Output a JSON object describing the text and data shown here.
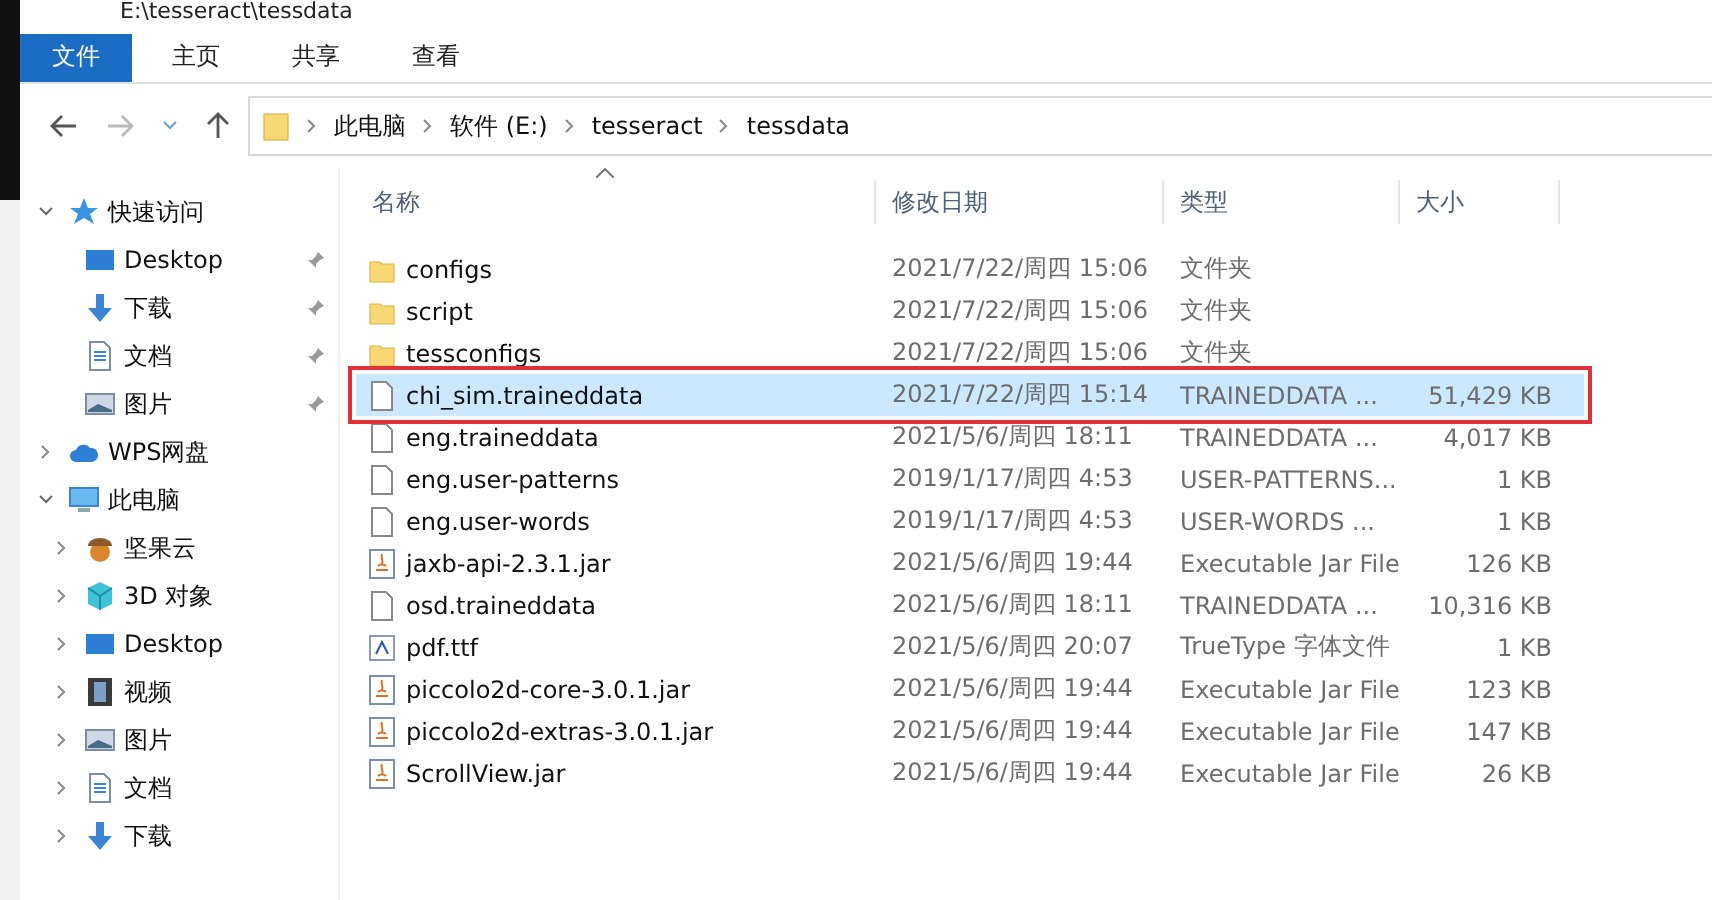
{
  "window": {
    "title": "E:\\tesseract\\tessdata"
  },
  "ribbon_tabs": [
    {
      "label": "文件",
      "selected": true
    },
    {
      "label": "主页",
      "selected": false
    },
    {
      "label": "共享",
      "selected": false
    },
    {
      "label": "查看",
      "selected": false
    }
  ],
  "breadcrumb": [
    "此电脑",
    "软件 (E:)",
    "tesseract",
    "tessdata"
  ],
  "sidebar": {
    "items": [
      {
        "label": "快速访问",
        "kind": "star",
        "expanded": true,
        "children": [
          {
            "label": "Desktop",
            "kind": "desktop",
            "pinned": true
          },
          {
            "label": "下载",
            "kind": "download",
            "pinned": true
          },
          {
            "label": "文档",
            "kind": "document",
            "pinned": true
          },
          {
            "label": "图片",
            "kind": "picture",
            "pinned": true
          }
        ]
      },
      {
        "label": "WPS网盘",
        "kind": "cloud",
        "expanded": false
      },
      {
        "label": "此电脑",
        "kind": "computer",
        "expanded": true,
        "children": [
          {
            "label": "坚果云",
            "kind": "nut",
            "expanded": false
          },
          {
            "label": "3D 对象",
            "kind": "cube",
            "expanded": false
          },
          {
            "label": "Desktop",
            "kind": "desktop",
            "expanded": false
          },
          {
            "label": "视频",
            "kind": "video",
            "expanded": false
          },
          {
            "label": "图片",
            "kind": "picture",
            "expanded": false
          },
          {
            "label": "文档",
            "kind": "document",
            "expanded": false
          },
          {
            "label": "下载",
            "kind": "download",
            "expanded": false
          }
        ]
      }
    ]
  },
  "table": {
    "columns": [
      "名称",
      "修改日期",
      "类型",
      "大小"
    ],
    "rows": [
      {
        "kind": "folder",
        "name": "configs",
        "date": "2021/7/22/周四 15:06",
        "type": "文件夹",
        "size": "",
        "selected": false,
        "outlined": false
      },
      {
        "kind": "folder",
        "name": "script",
        "date": "2021/7/22/周四 15:06",
        "type": "文件夹",
        "size": "",
        "selected": false,
        "outlined": false
      },
      {
        "kind": "folder",
        "name": "tessconfigs",
        "date": "2021/7/22/周四 15:06",
        "type": "文件夹",
        "size": "",
        "selected": false,
        "outlined": false
      },
      {
        "kind": "file",
        "name": "chi_sim.traineddata",
        "date": "2021/7/22/周四 15:14",
        "type": "TRAINEDDATA ...",
        "size": "51,429 KB",
        "selected": true,
        "outlined": true
      },
      {
        "kind": "file",
        "name": "eng.traineddata",
        "date": "2021/5/6/周四 18:11",
        "type": "TRAINEDDATA ...",
        "size": "4,017 KB",
        "selected": false,
        "outlined": false
      },
      {
        "kind": "file",
        "name": "eng.user-patterns",
        "date": "2019/1/17/周四 4:53",
        "type": "USER-PATTERNS...",
        "size": "1 KB",
        "selected": false,
        "outlined": false
      },
      {
        "kind": "file",
        "name": "eng.user-words",
        "date": "2019/1/17/周四 4:53",
        "type": "USER-WORDS ...",
        "size": "1 KB",
        "selected": false,
        "outlined": false
      },
      {
        "kind": "jar",
        "name": "jaxb-api-2.3.1.jar",
        "date": "2021/5/6/周四 19:44",
        "type": "Executable Jar File",
        "size": "126 KB",
        "selected": false,
        "outlined": false
      },
      {
        "kind": "file",
        "name": "osd.traineddata",
        "date": "2021/5/6/周四 18:11",
        "type": "TRAINEDDATA ...",
        "size": "10,316 KB",
        "selected": false,
        "outlined": false
      },
      {
        "kind": "font",
        "name": "pdf.ttf",
        "date": "2021/5/6/周四 20:07",
        "type": "TrueType 字体文件",
        "size": "1 KB",
        "selected": false,
        "outlined": false
      },
      {
        "kind": "jar",
        "name": "piccolo2d-core-3.0.1.jar",
        "date": "2021/5/6/周四 19:44",
        "type": "Executable Jar File",
        "size": "123 KB",
        "selected": false,
        "outlined": false
      },
      {
        "kind": "jar",
        "name": "piccolo2d-extras-3.0.1.jar",
        "date": "2021/5/6/周四 19:44",
        "type": "Executable Jar File",
        "size": "147 KB",
        "selected": false,
        "outlined": false
      },
      {
        "kind": "jar",
        "name": "ScrollView.jar",
        "date": "2021/5/6/周四 19:44",
        "type": "Executable Jar File",
        "size": "26 KB",
        "selected": false,
        "outlined": false
      }
    ]
  }
}
